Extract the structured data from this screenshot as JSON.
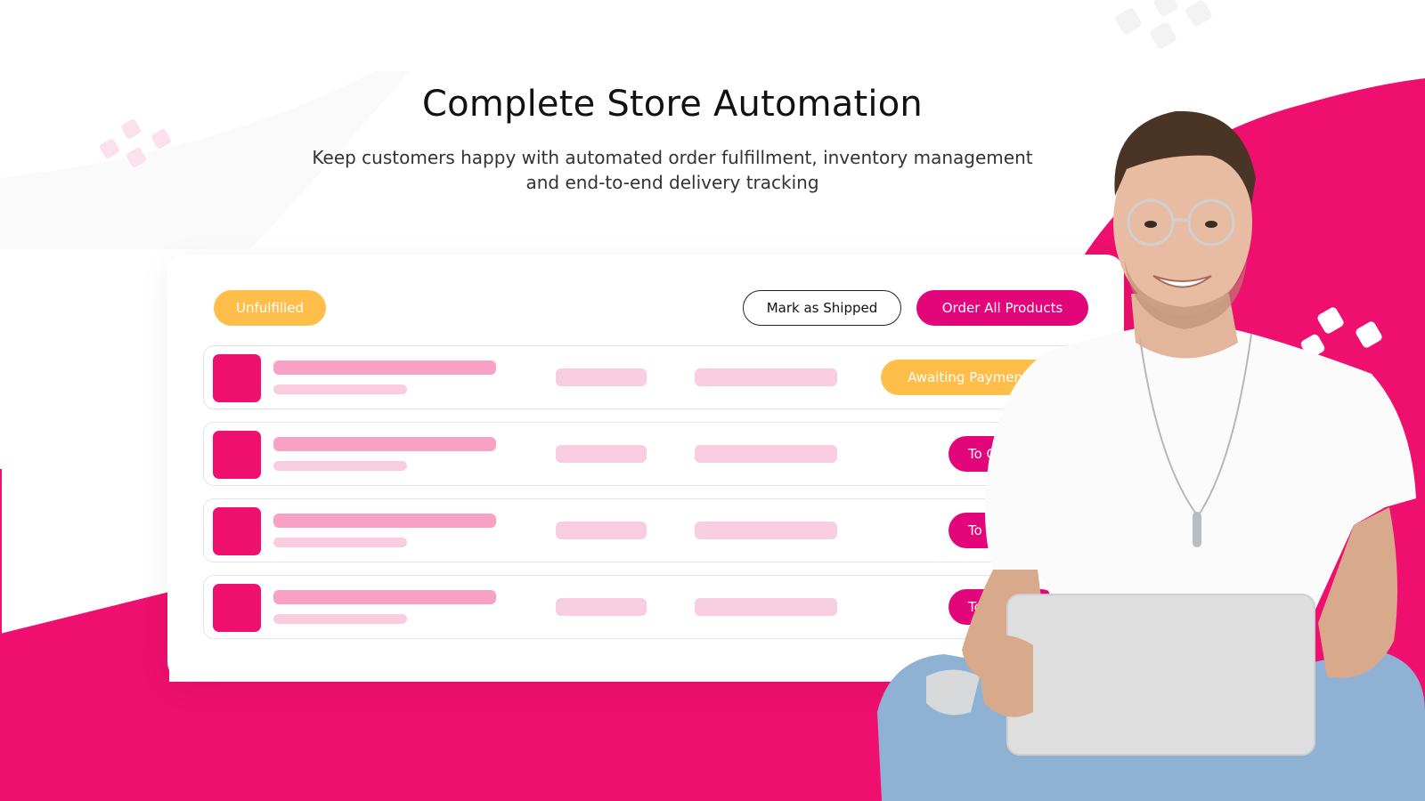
{
  "hero": {
    "title": "Complete Store Automation",
    "subtitle": "Keep customers happy with automated order fulfillment, inventory management and end-to-end delivery tracking"
  },
  "card": {
    "filter_badge": "Unfulfilled",
    "actions": {
      "mark_shipped": "Mark as Shipped",
      "order_all": "Order All Products"
    },
    "orders": [
      {
        "status": "Awaiting Payment",
        "status_color": "#ffbd4a"
      },
      {
        "status": "To Order",
        "status_color": "#e3057a"
      },
      {
        "status": "To Order",
        "status_color": "#e3057a"
      },
      {
        "status": "To Order",
        "status_color": "#e3057a"
      }
    ]
  },
  "colors": {
    "brand_pink": "#ee0f6e",
    "button_pink": "#e3057a",
    "badge_yellow": "#ffbd4a",
    "placeholder_pink_dark": "#f7a1c4",
    "placeholder_pink_light": "#f9cde0"
  },
  "illustration": {
    "subject": "smiling man with glasses holding laptop",
    "decorations": [
      "dots-cluster-icon",
      "dots-cluster-icon",
      "dots-cluster-icon"
    ]
  }
}
